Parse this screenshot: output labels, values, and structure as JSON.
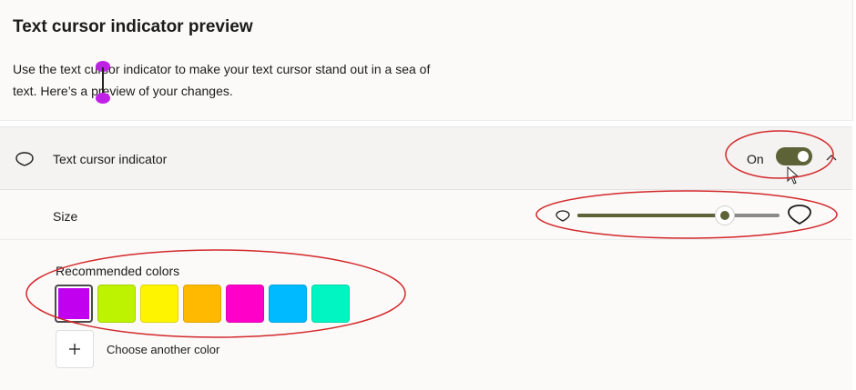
{
  "preview": {
    "title": "Text cursor indicator preview",
    "description": "Use the text cursor indicator to make your text cursor stand out in a sea of text. Here’s a preview of your changes."
  },
  "cursor_setting": {
    "label": "Text cursor indicator",
    "state_label": "On",
    "enabled": true
  },
  "size_setting": {
    "label": "Size",
    "value_fraction": 0.73
  },
  "colors": {
    "heading": "Recommended colors",
    "swatches": [
      "#c100f0",
      "#bdf200",
      "#fff400",
      "#ffba00",
      "#ff00c8",
      "#00baff",
      "#00f5c2"
    ],
    "selected_index": 0,
    "add_label": "Choose another color"
  },
  "accent_color": "#5d6336",
  "annotation_color": "#d3282b",
  "icons": [
    "cursor-indicator-icon",
    "chevron-up-icon",
    "mouse-pointer-icon",
    "plus-icon"
  ]
}
